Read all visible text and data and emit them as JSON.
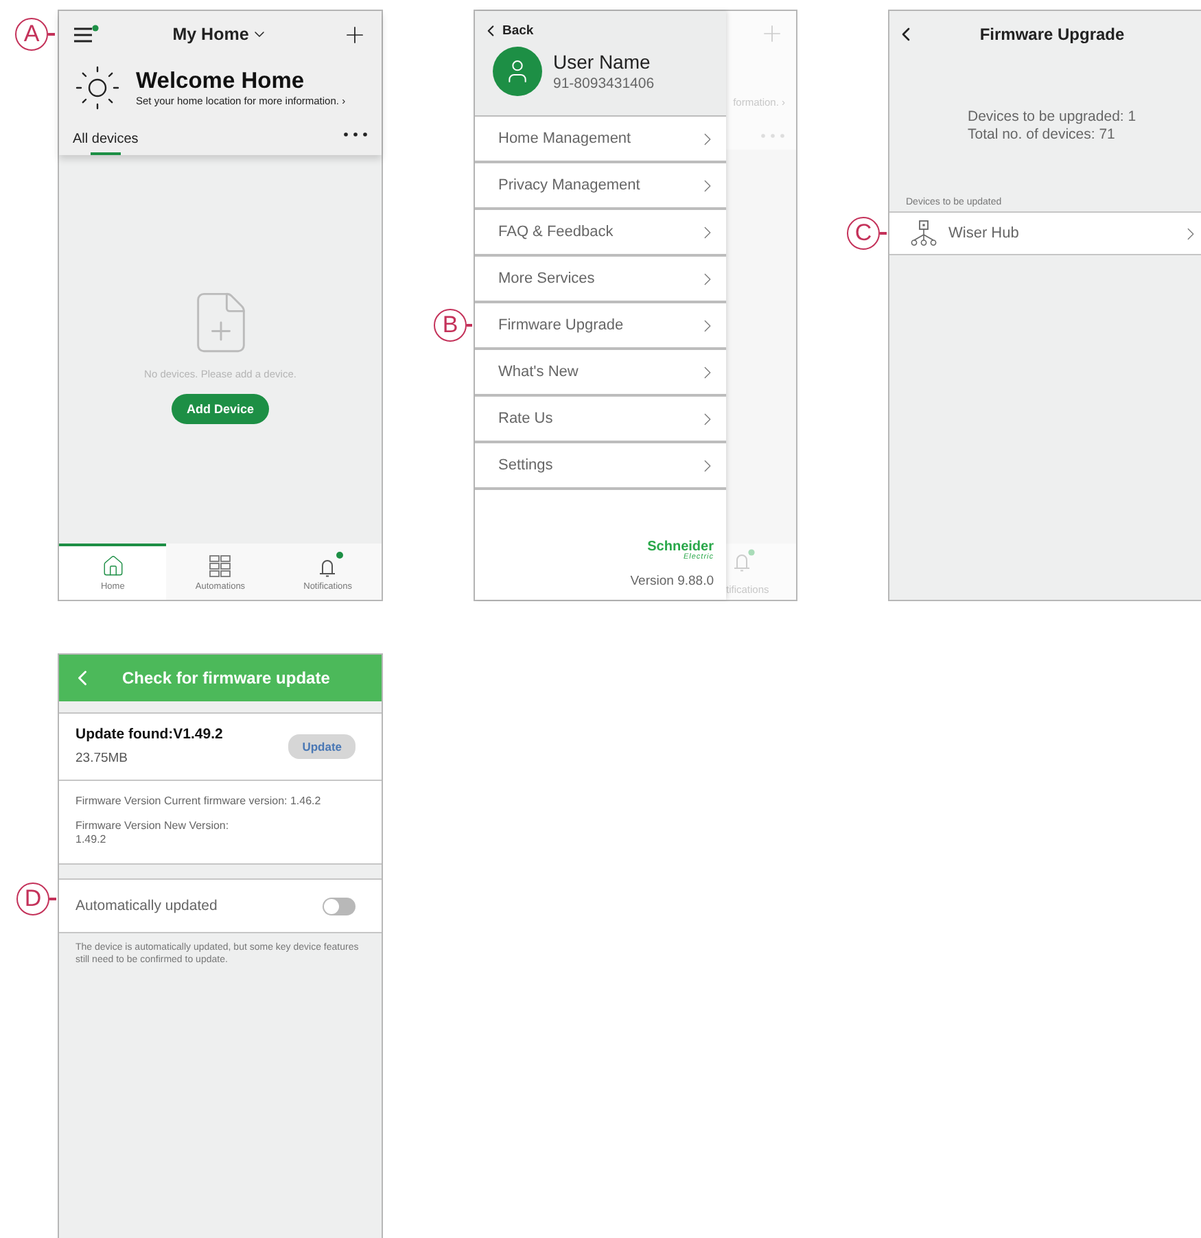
{
  "screens": [
    {
      "kind": "home",
      "title": "My Home",
      "menu_badge": true,
      "callout": "A",
      "welcome_title": "Welcome Home",
      "welcome_subtitle": "Set your home location for more information. ›",
      "tabs": [
        {
          "label": "All devices",
          "selected": true
        }
      ],
      "empty_text": "No devices. Please add a device.",
      "add_button": "Add Device",
      "nav": [
        {
          "label": "Home",
          "selected": true,
          "badge": false
        },
        {
          "label": "Automations",
          "selected": false,
          "badge": false
        },
        {
          "label": "Notifications",
          "selected": false,
          "badge": true
        }
      ]
    },
    {
      "kind": "menu",
      "back": "Back",
      "user_name": "User Name",
      "phone": "91-8093431406",
      "items": [
        {
          "label": "Home Management"
        },
        {
          "label": "Privacy Management"
        },
        {
          "label": "FAQ & Feedback"
        },
        {
          "label": "More Services"
        },
        {
          "label": "Firmware Upgrade",
          "callout": "B"
        },
        {
          "label": "What's New"
        },
        {
          "label": "Rate Us"
        },
        {
          "label": "Settings"
        }
      ],
      "logo": {
        "name": "Schneider",
        "sub": "Electric"
      },
      "version": "Version 9.88.0",
      "behind": {
        "subtitle_fragment": "formation. ›",
        "nav_fragment": "tifications"
      }
    },
    {
      "kind": "firmware",
      "title": "Firmware Upgrade",
      "summary": [
        "Devices to be upgraded: 1",
        "Total no. of devices: 71"
      ],
      "section_label": "Devices to be updated",
      "devices": [
        {
          "name": "Wiser Hub",
          "callout": "C"
        }
      ]
    },
    {
      "kind": "check",
      "title": "Check for firmware update",
      "update_title": "Update found:V1.49.2",
      "size": "23.75MB",
      "update_button": "Update",
      "versions": [
        "Firmware Version Current firmware version: 1.46.2",
        "Firmware Version New Version:\n1.49.2"
      ],
      "auto_update": {
        "label": "Automatically updated",
        "on": false,
        "callout": "D"
      },
      "note": "The device is automatically updated, but some key device features still need to be confirmed to update."
    }
  ]
}
